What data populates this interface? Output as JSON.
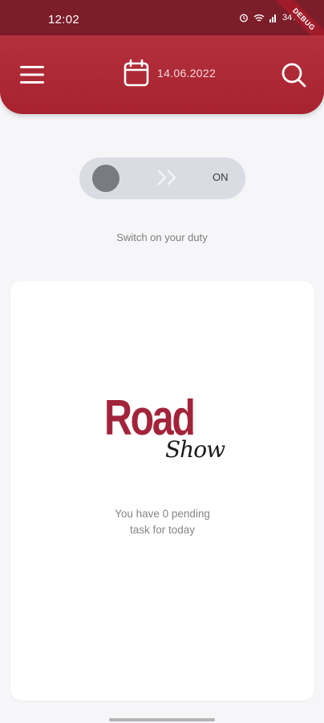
{
  "status_bar": {
    "time": "12:02",
    "battery": "34%",
    "debug_label": "DEBUG",
    "icons": [
      "alarm-icon",
      "wifi-icon",
      "signal-icon",
      "battery-icon"
    ]
  },
  "app_bar": {
    "date": "14.06.2022",
    "menu_icon": "hamburger-menu-icon",
    "calendar_icon": "calendar-icon",
    "search_icon": "search-icon",
    "color": "#a8222f"
  },
  "duty_toggle": {
    "state_label": "ON",
    "arrows": "›› ",
    "caption": "Switch on your duty"
  },
  "card": {
    "logo_line1": "Road",
    "logo_line2": "Show",
    "pending_line1": "You have 0 pending",
    "pending_line2": "task for today"
  },
  "colors": {
    "brand": "#a2243a",
    "status_bar": "#7c1d2a",
    "background": "#f6f6f8"
  }
}
